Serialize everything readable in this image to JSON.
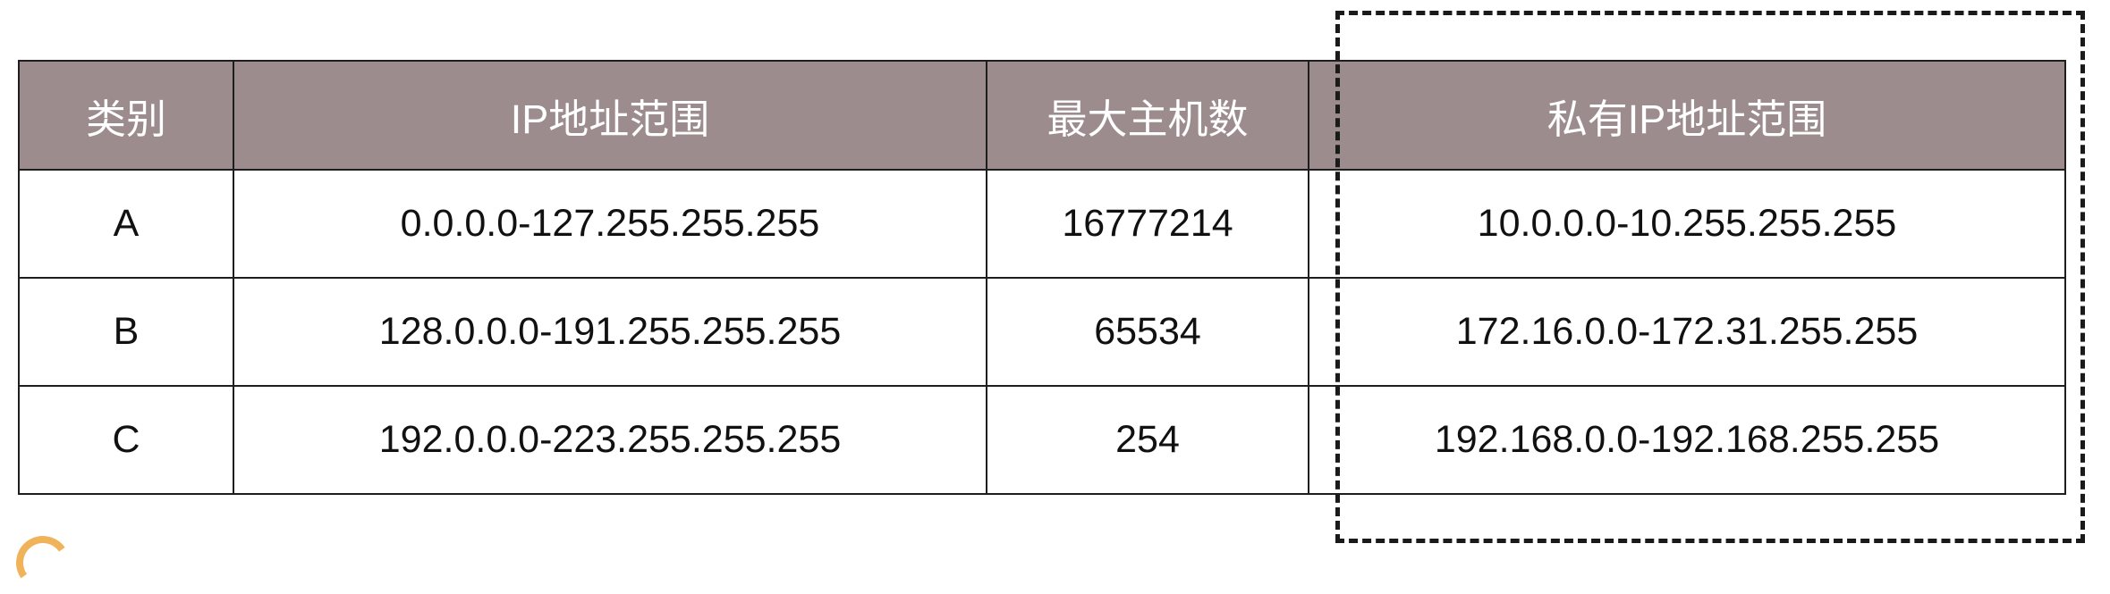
{
  "table": {
    "headers": [
      "类别",
      "IP地址范围",
      "最大主机数",
      "私有IP地址范围"
    ],
    "rows": [
      [
        "A",
        "0.0.0.0-127.255.255.255",
        "16777214",
        "10.0.0.0-10.255.255.255"
      ],
      [
        "B",
        "128.0.0.0-191.255.255.255",
        "65534",
        "172.16.0.0-172.31.255.255"
      ],
      [
        "C",
        "192.0.0.0-223.255.255.255",
        "254",
        "192.168.0.0-192.168.255.255"
      ]
    ]
  },
  "colors": {
    "header_background": "#9c8c8e",
    "header_text": "#ffffff",
    "border": "#1e1e1e",
    "highlight_box": "#1a1a1a"
  }
}
